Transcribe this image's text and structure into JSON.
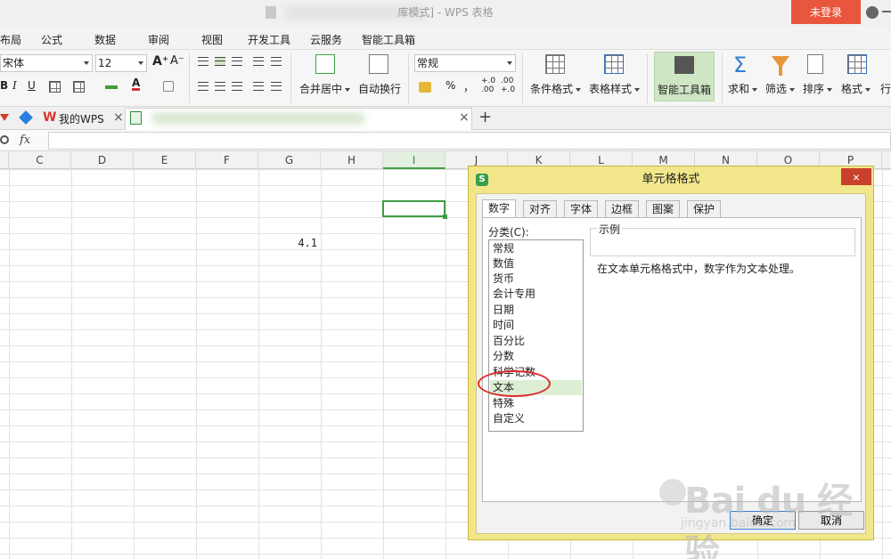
{
  "title": {
    "text": "库模式] - WPS 表格",
    "login_label": "未登录"
  },
  "menu": [
    "布局",
    "公式",
    "数据",
    "审阅",
    "视图",
    "开发工具",
    "云服务",
    "智能工具箱"
  ],
  "ribbon": {
    "font_name": "宋体",
    "font_size": "12",
    "number_format": "常规",
    "merge_label": "合并居中",
    "wrap_label": "自动换行",
    "cond_format_label": "条件格式",
    "table_style_label": "表格样式",
    "smart_toolbox_label": "智能工具箱",
    "sum_label": "求和",
    "filter_label": "筛选",
    "sort_label": "排序",
    "format_label": "格式",
    "rowcol_label": "行",
    "percent": "%",
    "comma": "，",
    "inc_decimal": "+.0 .00",
    "dec_decimal": ".00 +.0",
    "font_grow": "A⁺",
    "font_shrink": "A⁻",
    "bold": "B",
    "italic": "I",
    "underline": "U",
    "font_color_letter": "A",
    "sum_symbol": "Σ"
  },
  "tabs": {
    "my_wps": "我的WPS",
    "close": "×",
    "add": "+"
  },
  "formula": {
    "fx_label": "fx"
  },
  "columns": [
    "C",
    "D",
    "E",
    "F",
    "G",
    "H",
    "I",
    "J",
    "K",
    "L",
    "M",
    "N",
    "O",
    "P"
  ],
  "selected_column": "I",
  "cell": {
    "value": "4.1"
  },
  "dialog": {
    "title": "单元格格式",
    "close": "×",
    "tabs": [
      "数字",
      "对齐",
      "字体",
      "边框",
      "图案",
      "保护"
    ],
    "active_tab": "数字",
    "category_label": "分类(C):",
    "categories": [
      "常规",
      "数值",
      "货币",
      "会计专用",
      "日期",
      "时间",
      "百分比",
      "分数",
      "科学记数",
      "文本",
      "特殊",
      "自定义"
    ],
    "selected_category": "文本",
    "sample_label": "示例",
    "description": "在文本单元格格式中，数字作为文本处理。",
    "ok": "确定",
    "cancel": "取消"
  },
  "watermark": {
    "brand": "Bai du 经验",
    "url": "jingyan.baidu.com"
  },
  "colors": {
    "accent_green": "#3f9e45",
    "login_red": "#e8563d",
    "dialog_frame": "#f1e68a",
    "annotation_red": "#e02a2a"
  }
}
